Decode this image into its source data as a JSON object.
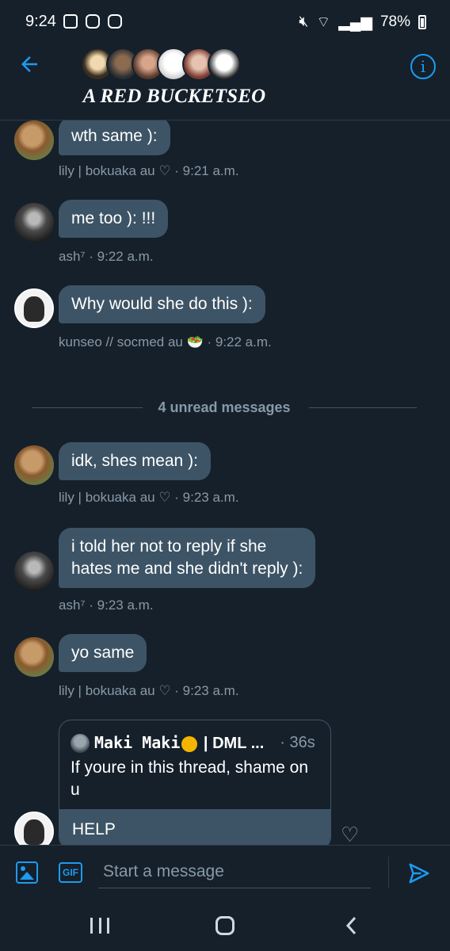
{
  "status_bar": {
    "time": "9:24",
    "battery": "78%"
  },
  "header": {
    "title": "A RED BUCKETSEO",
    "back_icon": "arrow-left-icon",
    "info_icon": "info-icon"
  },
  "messages": [
    {
      "text": "wth same ):",
      "meta": "lily | bokuaka au ♡ · 9:21 a.m."
    },
    {
      "text": "me too ): !!!",
      "meta": "ash⁷ · 9:22 a.m."
    },
    {
      "text": "Why would she do this ):",
      "meta": "kunseo // socmed au 🥗 · 9:22 a.m."
    },
    {
      "text": "idk, shes mean ):",
      "meta": "lily | bokuaka au ♡ · 9:23 a.m."
    },
    {
      "text": "i told her not to reply if she\nhates me and she didn't reply ):",
      "meta": "ash⁷ · 9:23 a.m."
    },
    {
      "text": "yo same",
      "meta": "lily | bokuaka au ♡ · 9:23 a.m."
    }
  ],
  "divider": {
    "label": "4 unread messages"
  },
  "quoted_tweet": {
    "name_prefix": "Maki Maki",
    "name_suffix": " | DML ...",
    "time": "· 36s",
    "text": "If youre in this thread, shame on u",
    "reply": "HELP"
  },
  "composer": {
    "placeholder": "Start a message",
    "gif_label": "GIF"
  },
  "colors": {
    "background": "#15202b",
    "bubble": "#3d5466",
    "accent": "#1d9bf0",
    "meta_text": "#8899a6"
  }
}
